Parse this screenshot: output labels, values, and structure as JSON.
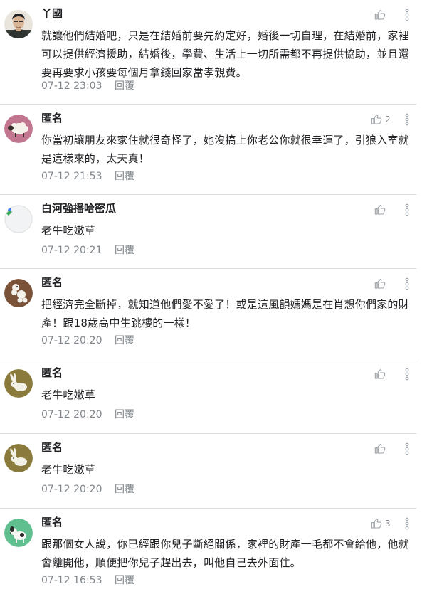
{
  "comments": [
    {
      "author": "丫國",
      "text": "就讓他們結婚吧，只是在結婚前要先約定好，婚後一切自理，在結婚前，家裡可以提供經濟援助，結婚後，學費、生活上一切所需都不再提供協助，並且還要再要求小孩要每個月拿錢回家當孝親費。",
      "time": "07-12 23:03",
      "reply_label": "回覆",
      "likes": "",
      "avatar_icon": "person-photo-avatar"
    },
    {
      "author": "匿名",
      "text": "你當初讓朋友來家住就很奇怪了，她沒搞上你老公你就很幸運了，引狼入室就是這樣來的，太天真！",
      "time": "07-12 21:53",
      "reply_label": "回覆",
      "likes": "2",
      "avatar_icon": "sheep-avatar"
    },
    {
      "author": "白河強播哈密瓜",
      "text": "老牛吃嫩草",
      "time": "07-12 20:21",
      "reply_label": "回覆",
      "likes": "",
      "avatar_icon": "broken-image-avatar"
    },
    {
      "author": "匿名",
      "text": "把經濟完全斷掉，就知道他們愛不愛了！或是這風韻媽媽是在肖想你們家的財產！跟18歲高中生跳樓的一樣！",
      "time": "07-12 20:20",
      "reply_label": "回覆",
      "likes": "",
      "avatar_icon": "poodle-avatar"
    },
    {
      "author": "匿名",
      "text": "老牛吃嫩草",
      "time": "07-12 20:20",
      "reply_label": "回覆",
      "likes": "",
      "avatar_icon": "rabbit-avatar"
    },
    {
      "author": "匿名",
      "text": "老牛吃嫩草",
      "time": "07-12 20:20",
      "reply_label": "回覆",
      "likes": "",
      "avatar_icon": "rabbit-avatar"
    },
    {
      "author": "匿名",
      "text": "跟那個女人說，你已經跟你兒子斷絕關係，家裡的財產一毛都不會給他，他就會離開他，順便把你兒子趕出去，叫他自己去外面住。",
      "time": "07-12 16:53",
      "reply_label": "回覆",
      "likes": "3",
      "avatar_icon": "dog-avatar"
    }
  ],
  "colors": {
    "text": "#202124",
    "muted": "#80868b",
    "divider": "#dadce0",
    "icon": "#9aa0a6"
  }
}
